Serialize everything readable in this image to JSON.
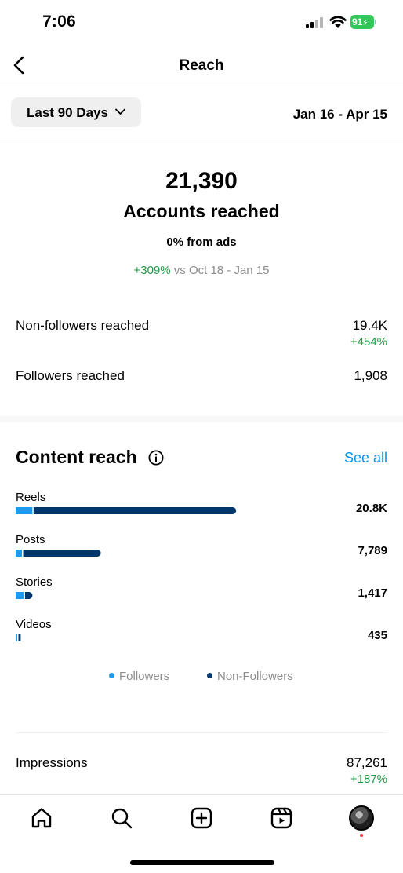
{
  "status_bar": {
    "time": "7:06",
    "battery": "91"
  },
  "header": {
    "title": "Reach"
  },
  "filter": {
    "range_label": "Last 90 Days",
    "date_range": "Jan 16 - Apr 15"
  },
  "summary": {
    "accounts_reached": "21,390",
    "accounts_label": "Accounts reached",
    "ads_note": "0% from ads",
    "change": "+309%",
    "compare_text": "vs Oct 18 - Jan 15"
  },
  "stats": [
    {
      "label": "Non-followers reached",
      "value": "19.4K",
      "change": "+454%"
    },
    {
      "label": "Followers reached",
      "value": "1,908",
      "change": ""
    }
  ],
  "content_reach": {
    "title": "Content reach",
    "see_all": "See all",
    "items": [
      {
        "label": "Reels",
        "value": "20.8K",
        "followers": 0.045,
        "non_followers": 0.545
      },
      {
        "label": "Posts",
        "value": "7,789",
        "followers": 0.017,
        "non_followers": 0.209
      },
      {
        "label": "Stories",
        "value": "1,417",
        "followers": 0.022,
        "non_followers": 0.02
      },
      {
        "label": "Videos",
        "value": "435",
        "followers": 0.002,
        "non_followers": 0.006
      }
    ],
    "legend": {
      "followers": "Followers",
      "non_followers": "Non-Followers"
    },
    "colors": {
      "followers": "#1d9bf0",
      "non_followers": "#00376b"
    }
  },
  "impressions": {
    "label": "Impressions",
    "value": "87,261",
    "change": "+187%"
  },
  "tab_bar": {
    "icons": [
      "home-icon",
      "search-icon",
      "create-icon",
      "reels-icon",
      "profile-avatar"
    ]
  }
}
